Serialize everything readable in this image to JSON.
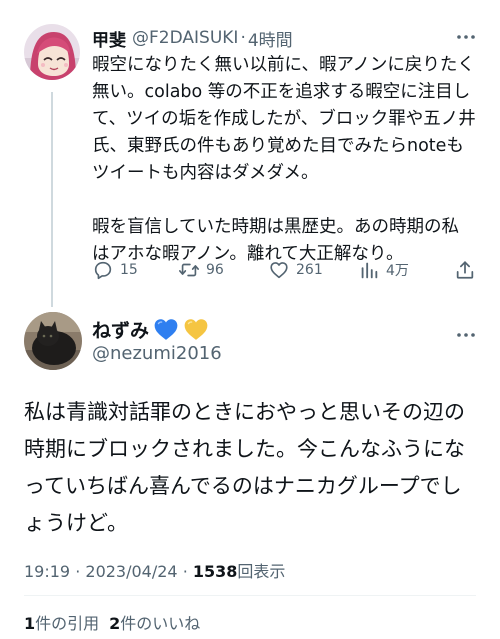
{
  "parent_tweet": {
    "author_name": "甲斐",
    "author_handle": "@F2DAISUKI",
    "separator": "·",
    "time": "4時間",
    "paragraph1": "暇空になりたく無い以前に、暇アノンに戻りたく無い。colabo 等の不正を追求する暇空に注目して、ツイの垢を作成したが、ブロック罪や五ノ井氏、東野氏の件もあり覚めた目でみたらnoteもツイートも内容はダメダメ。",
    "paragraph2": "暇を盲信していた時期は黒歴史。あの時期の私はアホな暇アノン。離れて大正解なり。",
    "actions": {
      "reply_count": "15",
      "retweet_count": "96",
      "like_count": "261",
      "view_count": "4万"
    },
    "icons": {
      "reply": "reply-icon",
      "retweet": "retweet-icon",
      "like": "heart-icon",
      "views": "views-icon",
      "share": "share-icon",
      "more": "more-icon"
    }
  },
  "reply_tweet": {
    "author_name": "ねずみ",
    "author_handle": "@nezumi2016",
    "name_emoji": [
      "blue-heart",
      "yellow-heart"
    ],
    "text": "私は青識対話罪のときにおやっと思いその辺の時期にブロックされました。今こんなふうになっていちばん喜んでるのはナニカグループでしょうけど。",
    "time": "19:19",
    "separator": "·",
    "date": "2023/04/24",
    "separator2": "·",
    "views_count": "1538",
    "views_label": "回表示",
    "quote_count": "1",
    "quote_label": "件の引用",
    "like_count": "2",
    "like_label": "件のいいね"
  },
  "colors": {
    "text_primary": "#0f1419",
    "text_secondary": "#536471",
    "divider": "#eff3f4",
    "thread_line": "#cfd9de",
    "blue_heart": "#2f7ff0",
    "yellow_heart": "#f5c542"
  }
}
